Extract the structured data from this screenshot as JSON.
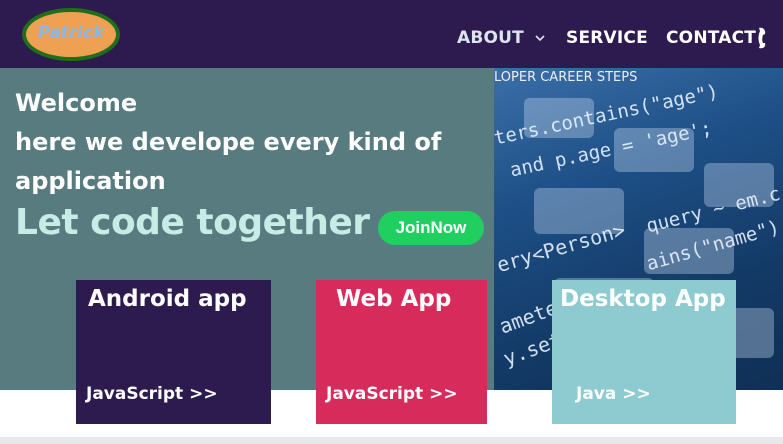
{
  "logo": {
    "text": "Patrick"
  },
  "nav": {
    "about": "ABOUT",
    "service": "SERVICE",
    "contact": "CONTACT"
  },
  "hero": {
    "welcome_line1": "Welcome",
    "welcome_line2": "here we develope every kind of",
    "welcome_line3": "application",
    "tagline": "Let code together",
    "join_button": "JoinNow"
  },
  "image": {
    "caption": "LOPER CAREER STEPS",
    "code_lines": [
      "ters.contains(\"age\")",
      "and p.age = 'age';",
      "query ~ em.c",
      "ery<Person>",
      "ains(\"name\")",
      "amete",
      "y.set"
    ]
  },
  "cards": [
    {
      "title": "Android app",
      "lang": "JavaScript  >>",
      "color": "#2d1b4f"
    },
    {
      "title": "Web App",
      "lang": "JavaScript  >>",
      "color": "#d72b5c"
    },
    {
      "title": "Desktop App",
      "lang": "Java  >>",
      "color": "#8ecbd1"
    }
  ],
  "colors": {
    "navbar": "#2d1b4f",
    "hero": "#577b7f",
    "join_button": "#1fcf5f",
    "logo_fill": "#f0a052",
    "logo_ring": "#1f6f1a"
  },
  "icons": {
    "about_dropdown": "chevron-down-icon",
    "contact": "phone-icon"
  }
}
